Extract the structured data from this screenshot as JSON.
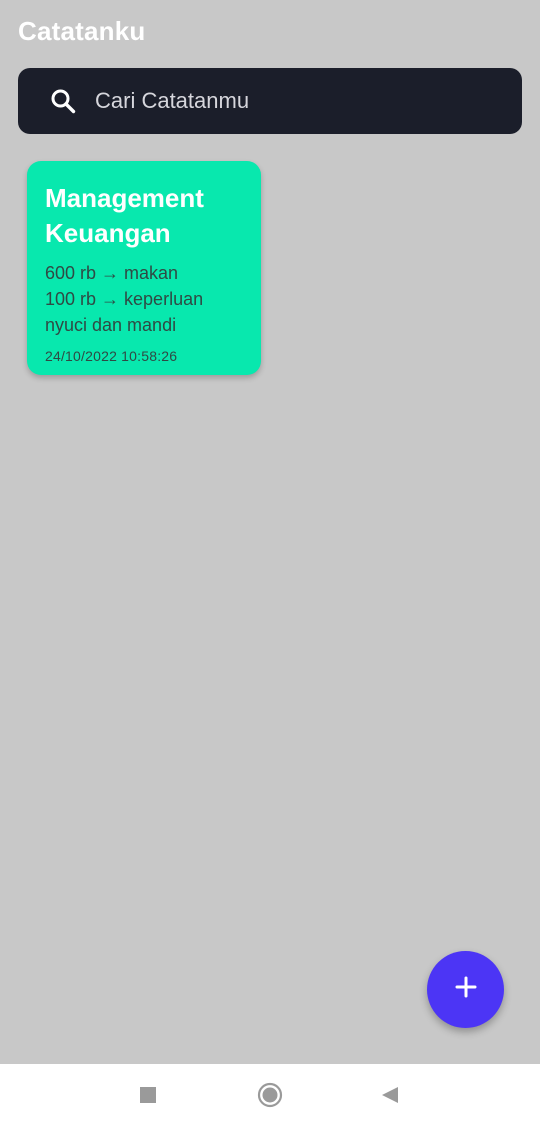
{
  "app": {
    "title": "Catatanku"
  },
  "search": {
    "placeholder": "Cari Catatanmu",
    "icon": "search-icon"
  },
  "notes": [
    {
      "title": "Management Keuangan",
      "body_lines": [
        "600 rb → makan",
        "100 rb → keperluan",
        "nyuci dan mandi"
      ],
      "date": "24/10/2022 10:58:26",
      "color": "#08e8ae"
    }
  ],
  "fab": {
    "icon": "plus-icon",
    "color": "#4c35f5"
  },
  "nav": {
    "items": [
      "recents-icon",
      "home-icon",
      "back-icon"
    ]
  },
  "colors": {
    "background": "#c8c8c8",
    "search_bar": "#1b1e2a",
    "accent": "#4c35f5"
  }
}
